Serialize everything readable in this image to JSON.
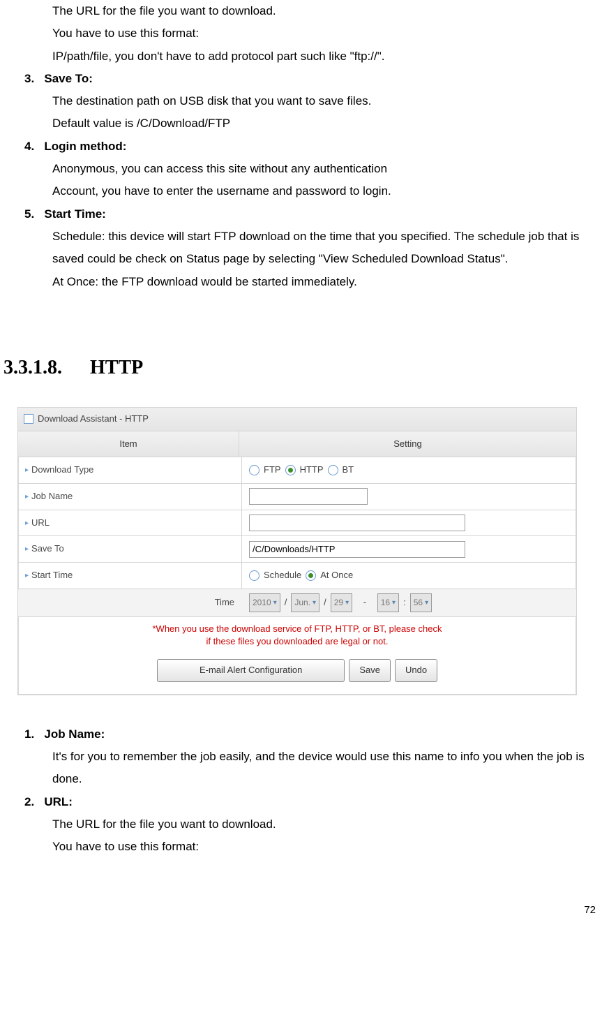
{
  "top": {
    "line1": "The URL for the file you want to download.",
    "line2": "You have to use this format:",
    "line3": "IP/path/file, you don't have to add protocol part such like \"ftp://\"."
  },
  "item3": {
    "num": "3.",
    "title": "Save To:",
    "l1": "The destination path on USB disk that you want to save files.",
    "l2": "Default value is /C/Download/FTP"
  },
  "item4": {
    "num": "4.",
    "title": "Login method:",
    "l1": "Anonymous, you can access this site without any authentication",
    "l2": "Account, you have to enter the username and password to login."
  },
  "item5": {
    "num": "5.",
    "title": "Start Time:",
    "l1": "Schedule: this device will start FTP download on the time that you specified. The schedule job that is saved could be check on Status page by selecting \"View Scheduled Download Status\".",
    "l2": "At Once: the FTP download would be started immediately."
  },
  "section": {
    "num": "3.3.1.8.",
    "name": "HTTP"
  },
  "shot": {
    "title": "Download Assistant - HTTP",
    "header": {
      "c1": "Item",
      "c2": "Setting"
    },
    "rows": {
      "type": {
        "label": "Download Type",
        "opt1": "FTP",
        "opt2": "HTTP",
        "opt3": "BT"
      },
      "job": {
        "label": "Job Name"
      },
      "url": {
        "label": "URL"
      },
      "save": {
        "label": "Save To",
        "value": "/C/Downloads/HTTP"
      },
      "start": {
        "label": "Start Time",
        "opt1": "Schedule",
        "opt2": "At Once"
      },
      "time": {
        "label": "Time",
        "y": "2010",
        "m": "Jun.",
        "d": "29",
        "h": "16",
        "mi": "56",
        "sep1": "/",
        "sep2": "/",
        "sep3": "-",
        "sep4": ":"
      }
    },
    "warn1": "*When you use the download service of FTP, HTTP, or BT, please check",
    "warn2": "if these files you downloaded are legal or not.",
    "buttons": {
      "b1": "E-mail Alert Configuration",
      "b2": "Save",
      "b3": "Undo"
    }
  },
  "bottom": {
    "i1": {
      "num": "1.",
      "title": "Job Name:",
      "l1": "It's for you to remember the job easily, and the device would use this name to info you when the job is done."
    },
    "i2": {
      "num": "2.",
      "title": "URL:",
      "l1": "The URL for the file you want to download.",
      "l2": "You have to use this format:"
    }
  },
  "page": "72"
}
